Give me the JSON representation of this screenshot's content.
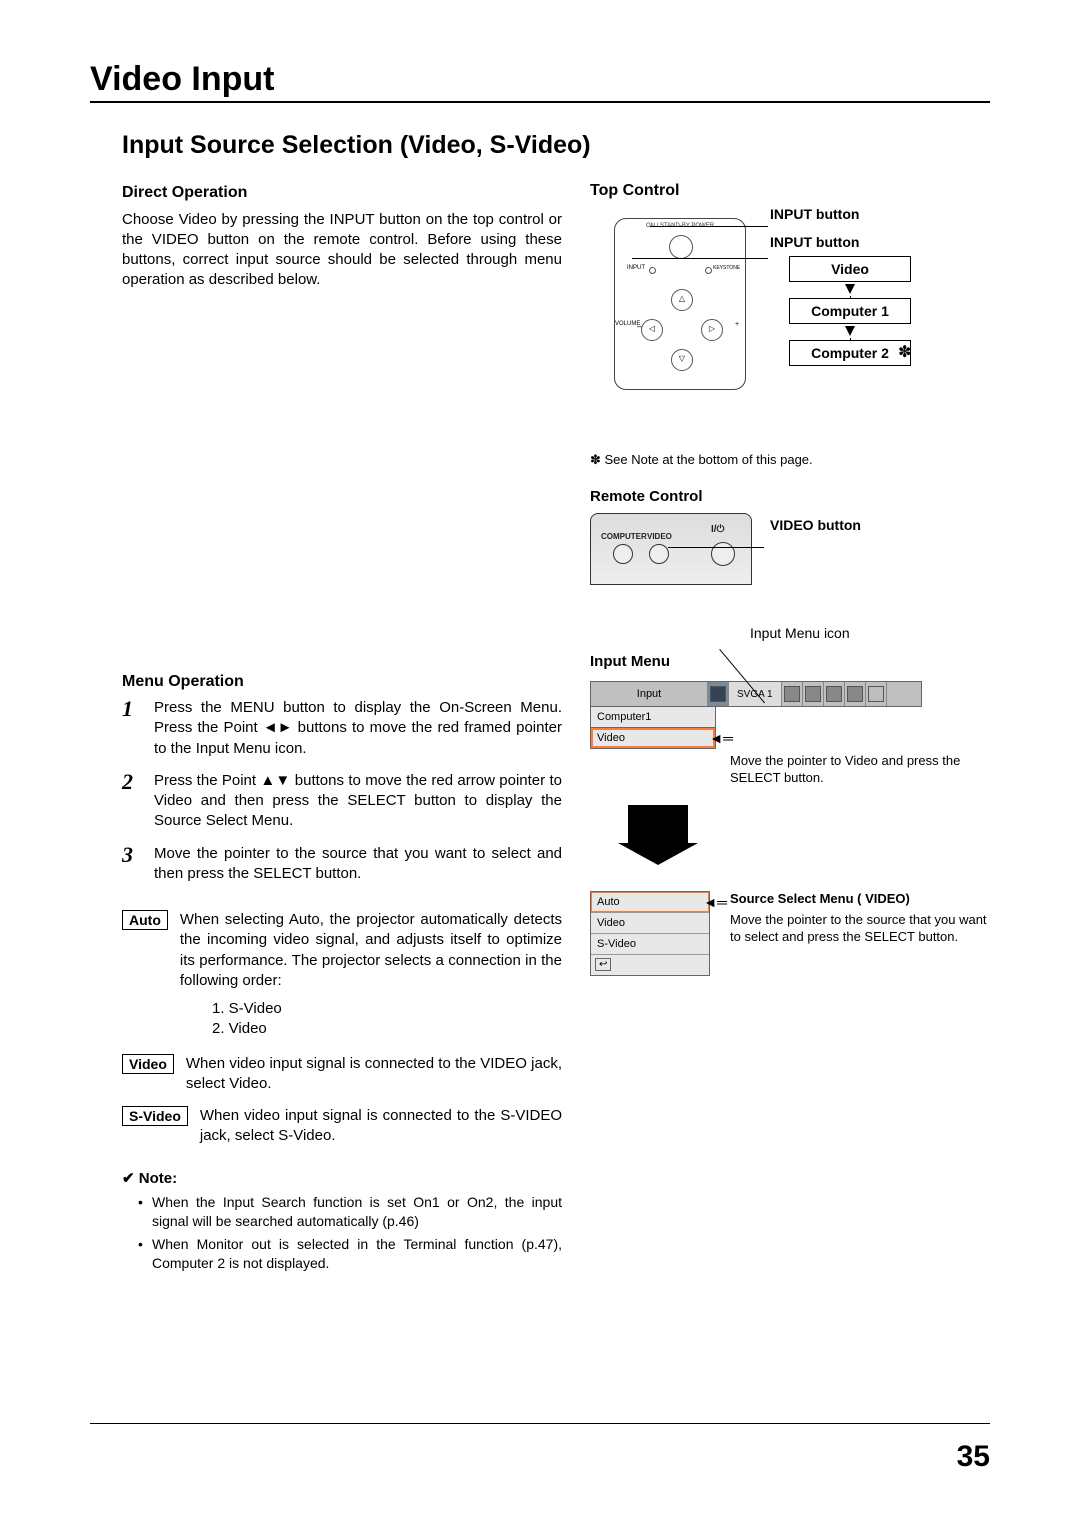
{
  "header": {
    "title": "Video Input"
  },
  "section": {
    "title": "Input Source Selection (Video, S-Video)"
  },
  "direct_op": {
    "heading": "Direct Operation",
    "body": "Choose Video by pressing the INPUT button on the top control or the VIDEO button on the remote control. Before using these buttons, correct input source should be selected through menu operation as described below."
  },
  "menu_op": {
    "heading": "Menu Operation",
    "steps": [
      "Press the MENU button to display the On-Screen Menu. Press the Point ◄► buttons to move the red framed pointer to the Input Menu icon.",
      "Press the Point ▲▼ buttons to move the red arrow pointer to Video and then press the SELECT button to display the Source Select Menu.",
      "Move the pointer to the source that you want to select and then press the SELECT button."
    ],
    "options": {
      "auto": {
        "label": "Auto",
        "text": "When selecting Auto, the projector automatically detects the incoming video signal, and adjusts itself to optimize its performance. The projector selects a connection in the following order:",
        "order": [
          "1. S-Video",
          "2. Video"
        ]
      },
      "video": {
        "label": "Video",
        "text": "When video input signal is connected to the VIDEO jack, select Video."
      },
      "svideo": {
        "label": "S-Video",
        "text": "When video input signal is connected to the S-VIDEO jack, select S-Video."
      }
    }
  },
  "note": {
    "heading": "✔ Note:",
    "items": [
      "When the Input Search function is set On1 or On2, the input signal will be searched automatically (p.46)",
      "When Monitor out is selected in the Terminal function (p.47), Computer 2 is not displayed."
    ]
  },
  "top_control": {
    "heading": "Top Control",
    "panel_label_top": "ON / STAND-BY   POWER",
    "panel_label_left": "VOLUME",
    "panel_label_input": "INPUT",
    "panel_label_keystone": "KEYSTONE",
    "callout1": "INPUT button",
    "callout2": "INPUT button",
    "flow": [
      "Video",
      "Computer 1",
      "Computer 2"
    ],
    "star": "✽",
    "footnote": "✽ See Note at the bottom of this page."
  },
  "remote": {
    "heading": "Remote Control",
    "btn_computer_lbl": "COMPUTER",
    "btn_video_lbl": "VIDEO",
    "power_icon": "I/⏻",
    "callout": "VIDEO button"
  },
  "input_menu": {
    "heading": "Input Menu",
    "icon_label": "Input Menu icon",
    "bar_label": "Input",
    "bar_mode": "SVGA 1",
    "rows": [
      "Computer1",
      "Video"
    ],
    "note": "Move the pointer to Video and press the SELECT button.",
    "arrow_label": "Video",
    "ssm_heading": "Source Select Menu ( VIDEO)",
    "ssm_rows": [
      "Auto",
      "Video",
      "S-Video"
    ],
    "ssm_note": "Move the pointer to the source that you want to select and press the SELECT button.",
    "ssm_back_icon": "↩"
  },
  "page_number": "35"
}
